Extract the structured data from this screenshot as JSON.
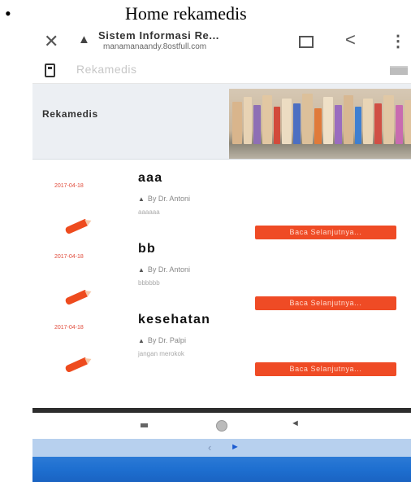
{
  "caption": {
    "bullet": "•",
    "text": "Home rekamedis"
  },
  "browser": {
    "tab_title": "Sistem Informasi Re...",
    "url": "manamanaandy.8ostfull.com",
    "warn_icon": "warning-icon",
    "icons": [
      "close-icon",
      "tabs-icon",
      "share-icon",
      "menu-icon"
    ]
  },
  "site": {
    "brand": "Rekamedis",
    "icons": [
      "logo-icon",
      "hamburger-icon"
    ]
  },
  "banner": {
    "title": "Rekamedis"
  },
  "posts": [
    {
      "date": "2017-04-18",
      "title": "aaa",
      "author": "By Dr. Antoni",
      "excerpt": "aaaaaa",
      "button": "Baca Selanjutnya..."
    },
    {
      "date": "2017-04-18",
      "title": "bb",
      "author": "By Dr. Antoni",
      "excerpt": "bbbbbb",
      "button": "Baca Selanjutnya..."
    },
    {
      "date": "2017-04-18",
      "title": "kesehatan",
      "author": "By Dr. Palpi",
      "excerpt": "jangan merokok",
      "button": "Baca Selanjutnya..."
    }
  ],
  "nav": {
    "back_glyph": "◄",
    "prev_glyph": "‹",
    "next_glyph": "►"
  },
  "colors": {
    "accent": "#ef4b25",
    "date": "#e04a3a",
    "banner_bg": "#eceff3",
    "taskbar": "#1e6fd0",
    "pager": "#b7d0ee"
  }
}
